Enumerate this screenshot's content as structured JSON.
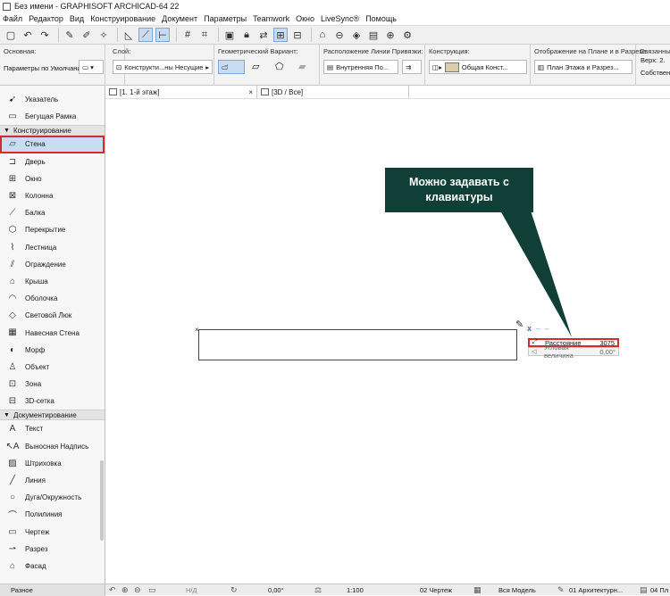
{
  "window": {
    "title": "Без имени - GRAPHISOFT ARCHICAD-64 22"
  },
  "menu": [
    "Файл",
    "Редактор",
    "Вид",
    "Конструирование",
    "Документ",
    "Параметры",
    "Teamwork",
    "Окно",
    "LiveSync®",
    "Помощь"
  ],
  "infobox": {
    "main_label": "Основная:",
    "default_params": "Параметры по Умолчанию",
    "layer_label": "Слой:",
    "layer_value": "Конструкти...ны Несущие",
    "geometry_label": "Геометрический Вариант:",
    "refline_label": "Расположение Линии Привязки:",
    "refline_value": "Внутренняя По...",
    "construction_label": "Конструкция:",
    "construction_value": "Общая Конст...",
    "display_label": "Отображение на Плане и в Разрезе:",
    "display_value": "План Этажа и Разрез...",
    "linked_label": "Связанные",
    "top_label": "Верх:",
    "top_value": "2.",
    "own_label": "Собственны"
  },
  "sidebar": {
    "top_tools": [
      {
        "label": "Указатель",
        "icon": "pointer-icon"
      },
      {
        "label": "Бегущая Рамка",
        "icon": "marquee-icon"
      }
    ],
    "design_group": "Конструирование",
    "design_tools": [
      {
        "label": "Стена",
        "icon": "wall-icon",
        "selected": true
      },
      {
        "label": "Дверь",
        "icon": "door-icon"
      },
      {
        "label": "Окно",
        "icon": "window-icon"
      },
      {
        "label": "Колонна",
        "icon": "column-icon"
      },
      {
        "label": "Балка",
        "icon": "beam-icon"
      },
      {
        "label": "Перекрытие",
        "icon": "slab-icon"
      },
      {
        "label": "Лестница",
        "icon": "stair-icon"
      },
      {
        "label": "Ограждение",
        "icon": "railing-icon"
      },
      {
        "label": "Крыша",
        "icon": "roof-icon"
      },
      {
        "label": "Оболочка",
        "icon": "shell-icon"
      },
      {
        "label": "Световой Люк",
        "icon": "skylight-icon"
      },
      {
        "label": "Навесная Стена",
        "icon": "curtain-wall-icon"
      },
      {
        "label": "Морф",
        "icon": "morph-icon"
      },
      {
        "label": "Объект",
        "icon": "object-icon"
      },
      {
        "label": "Зона",
        "icon": "zone-icon"
      },
      {
        "label": "3D-сетка",
        "icon": "mesh-icon"
      }
    ],
    "doc_group": "Документирование",
    "doc_tools": [
      {
        "label": "Текст",
        "icon": "text-icon"
      },
      {
        "label": "Выносная Надпись",
        "icon": "label-icon"
      },
      {
        "label": "Штриховка",
        "icon": "fill-icon"
      },
      {
        "label": "Линия",
        "icon": "line-icon"
      },
      {
        "label": "Дуга/Окружность",
        "icon": "arc-icon"
      },
      {
        "label": "Полилиния",
        "icon": "polyline-icon"
      },
      {
        "label": "Чертеж",
        "icon": "drawing-icon"
      },
      {
        "label": "Разрез",
        "icon": "section-icon"
      },
      {
        "label": "Фасад",
        "icon": "elevation-icon"
      }
    ],
    "misc_group": "Разное"
  },
  "tabs": [
    {
      "label": "[1. 1-й этаж]",
      "close": "×"
    },
    {
      "label": "[3D / Все]"
    }
  ],
  "canvas": {
    "callout": "Можно задавать с клавиатуры",
    "tracker": [
      {
        "label": "Расстояние",
        "value": "3075"
      },
      {
        "label": "Угловая величина",
        "value": "0,00°"
      }
    ]
  },
  "status": {
    "nd": "Н/Д",
    "angle": "0,00°",
    "scale": "1:100",
    "drawing": "02 Чертеж",
    "model": "Вся Модель",
    "arch": "01 Архитектурн...",
    "plan": "04 Пл"
  },
  "colors": {
    "callout_bg": "#0f3f36",
    "highlight_red": "#d42b2b",
    "selected_blue": "#c9ddf2"
  }
}
